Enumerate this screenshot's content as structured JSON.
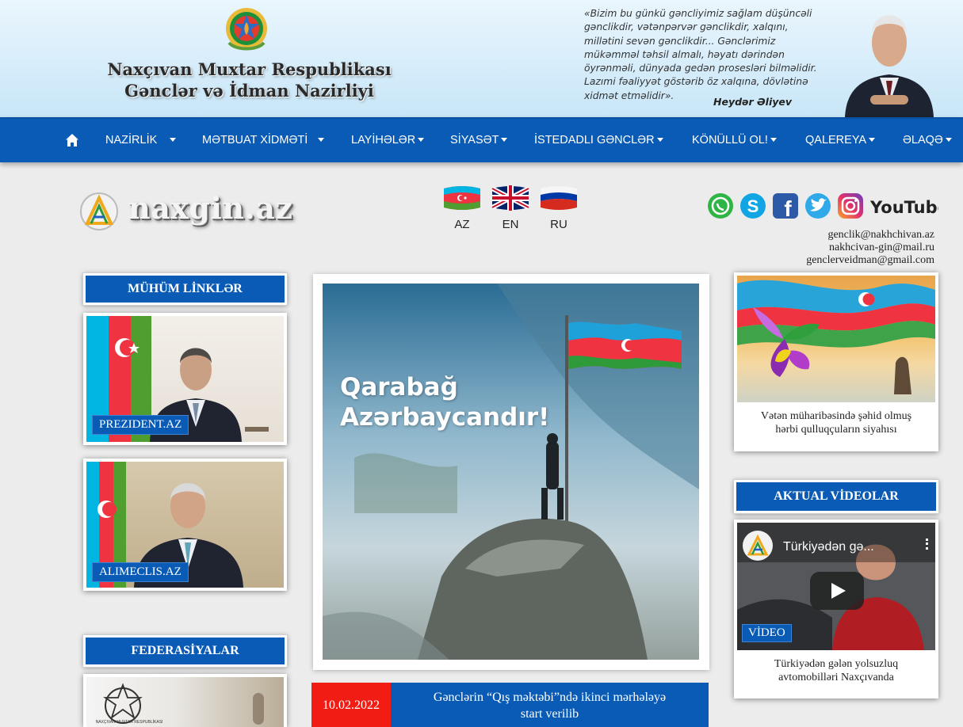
{
  "header": {
    "title_line1": "Naxçıvan Muxtar Respublikası",
    "title_line2": "Gənclər və İdman Nazirliyi",
    "quote_lines": [
      "«Bizim bu günkü gəncliyimiz sağlam düşüncəli",
      "gənclikdir, vətənpərvər gənclikdir, xalqını,",
      "millətini sevən gənclikdir... Gənclərimiz",
      "mükəmməl təhsil almalı, həyatı dərindən",
      "öyrənməli, dünyada gedən prosesləri bilməlidir.",
      "Lazımi fəaliyyət göstərib öz xalqına, dövlətinə",
      "xidmət etməlidir»."
    ],
    "quote_author": "Heydər Əliyev"
  },
  "nav": {
    "home_icon": "home-icon",
    "items": [
      {
        "label": "NAZİRLİK"
      },
      {
        "label": "MƏTBUAT XİDMƏTİ"
      },
      {
        "label": "LAYİHƏLƏR"
      },
      {
        "label": "SİYASƏT"
      },
      {
        "label": "İSTEDADLI GƏNCLƏR"
      },
      {
        "label": "KÖNÜLLÜ OL!"
      },
      {
        "label": "QALEREYA"
      },
      {
        "label": "ƏLAQƏ"
      }
    ]
  },
  "logo": {
    "text": "naxgin.az"
  },
  "languages": [
    {
      "code": "AZ"
    },
    {
      "code": "EN"
    },
    {
      "code": "RU"
    }
  ],
  "social": [
    "whatsapp-icon",
    "skype-icon",
    "facebook-icon",
    "twitter-icon",
    "instagram-icon",
    "youtube-icon"
  ],
  "youtube_word": "YouTube",
  "emails": [
    "genclik@nakhchivan.az",
    "nakhcivan-gin@mail.ru",
    "genclerveidman@gmail.com"
  ],
  "left": {
    "links_title": "MÜHÜM LİNKLƏR",
    "link1_label": "PREZIDENT.AZ",
    "link2_label": "ALIMECLIS.AZ",
    "federations_title": "FEDERASİYALAR",
    "federation_small_text": "NAXÇIVAN MUXTAR RESPUBLİKASI"
  },
  "center": {
    "banner_line1": "Qarabağ",
    "banner_line2": "Azərbaycandır!",
    "news_date": "10.02.2022",
    "news_title_line1": "Gənclərin “Qış məktəbi”ndə ikinci mərhələyə",
    "news_title_line2": "start verilib"
  },
  "right": {
    "martyrs_caption_line1": "Vətən müharibəsində şəhid olmuş",
    "martyrs_caption_line2": "hərbi qulluqçuların siyahısı",
    "videos_title": "AKTUAL VİDEOLAR",
    "video_overlay_title": "Türkiyədən gə...",
    "video_badge": "VİDEO",
    "video_caption_line1": "Türkiyədən gələn yolsuzluq",
    "video_caption_line2": "avtomobilləri Naxçıvanda"
  },
  "colors": {
    "brand_blue": "#0a5bb5",
    "date_red": "#f11d14",
    "header_bg": "#d5ecfa"
  }
}
